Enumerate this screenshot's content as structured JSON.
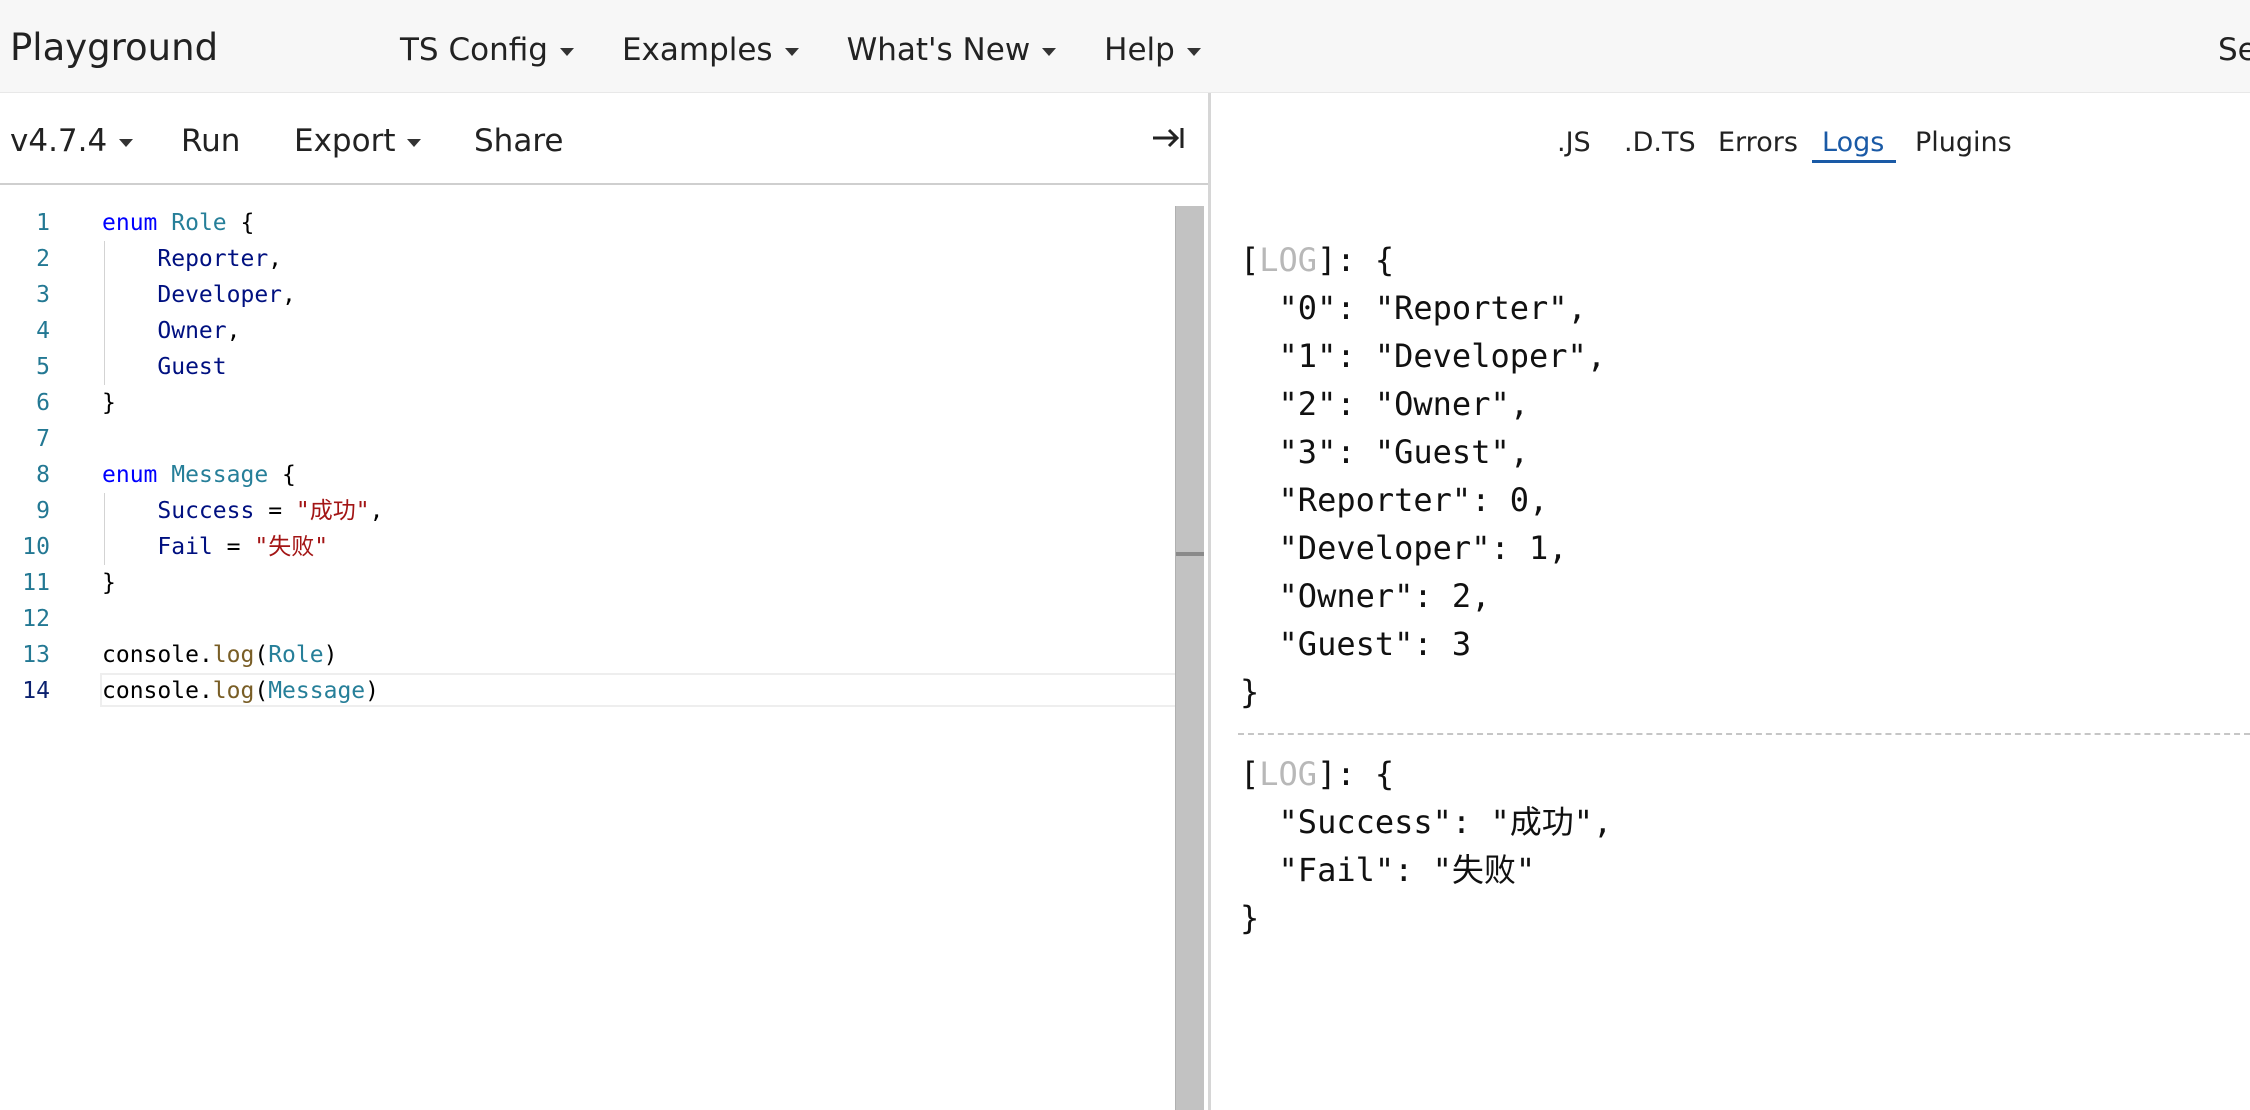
{
  "topnav": {
    "brand": "Playground",
    "menu": [
      {
        "label": "TS Config"
      },
      {
        "label": "Examples"
      },
      {
        "label": "What's New"
      },
      {
        "label": "Help"
      }
    ],
    "search_clip": "Se"
  },
  "toolbar": {
    "version": "v4.7.4",
    "run": "Run",
    "export": "Export",
    "share": "Share",
    "collapse_icon": "sidebar-collapse-icon"
  },
  "editor": {
    "line_numbers": [
      "1",
      "2",
      "3",
      "4",
      "5",
      "6",
      "7",
      "8",
      "9",
      "10",
      "11",
      "12",
      "13",
      "14"
    ],
    "active_line": 14,
    "code": {
      "l1": {
        "kw": "enum",
        "name": "Role",
        "brace": "{"
      },
      "l2": {
        "id": "Reporter",
        "p": ","
      },
      "l3": {
        "id": "Developer",
        "p": ","
      },
      "l4": {
        "id": "Owner",
        "p": ","
      },
      "l5": {
        "id": "Guest"
      },
      "l6": {
        "brace": "}"
      },
      "l8": {
        "kw": "enum",
        "name": "Message",
        "brace": "{"
      },
      "l9": {
        "id": "Success",
        "op": "=",
        "str": "\"成功\"",
        "p": ","
      },
      "l10": {
        "id": "Fail",
        "op": "=",
        "str": "\"失败\""
      },
      "l11": {
        "brace": "}"
      },
      "l13": {
        "obj": "console",
        "fn": "log",
        "open": "(",
        "arg": "Role",
        "close": ")"
      },
      "l14": {
        "obj": "console",
        "fn": "log",
        "open": "(",
        "arg": "Message",
        "close": ")"
      }
    }
  },
  "output": {
    "tabs": [
      {
        "label": ".JS"
      },
      {
        "label": ".D.TS"
      },
      {
        "label": "Errors"
      },
      {
        "label": "Logs"
      },
      {
        "label": "Plugins"
      }
    ],
    "active_tab": "Logs",
    "logs": [
      {
        "tag": "LOG",
        "lines": [
          "\"0\": \"Reporter\",",
          "\"1\": \"Developer\",",
          "\"2\": \"Owner\",",
          "\"3\": \"Guest\",",
          "\"Reporter\": 0,",
          "\"Developer\": 1,",
          "\"Owner\": 2,",
          "\"Guest\": 3"
        ]
      },
      {
        "tag": "LOG",
        "lines": [
          "\"Success\": \"成功\",",
          "\"Fail\": \"失败\""
        ]
      }
    ]
  }
}
